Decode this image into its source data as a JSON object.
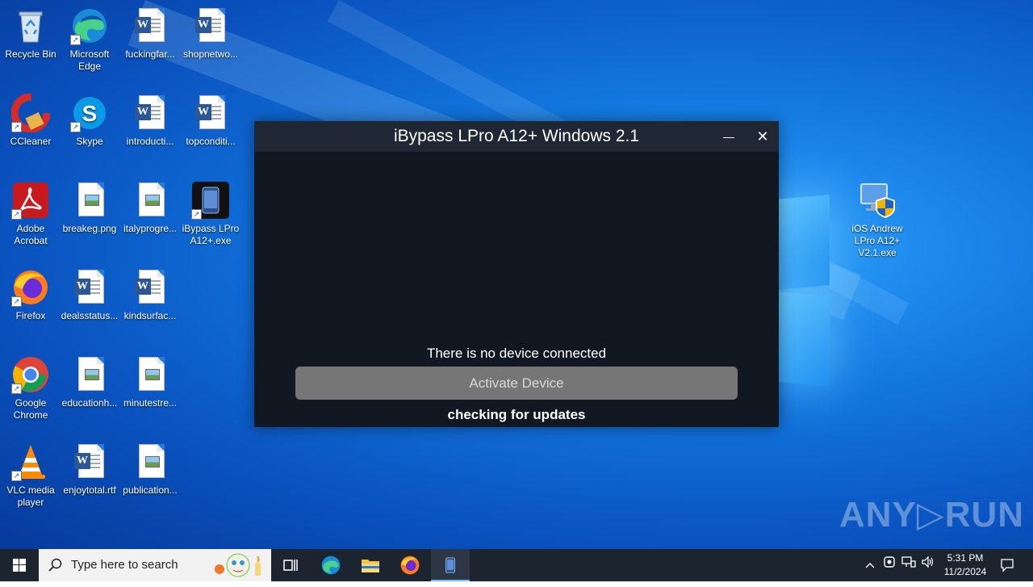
{
  "desktop": {
    "icons": [
      {
        "label": "Recycle Bin"
      },
      {
        "label": "Microsoft Edge"
      },
      {
        "label": "fuckingfar..."
      },
      {
        "label": "shopnetwo..."
      },
      {
        "label": "CCleaner"
      },
      {
        "label": "Skype"
      },
      {
        "label": "introducti..."
      },
      {
        "label": "topconditi..."
      },
      {
        "label": "Adobe Acrobat"
      },
      {
        "label": "breakeg.png"
      },
      {
        "label": "italyprogre..."
      },
      {
        "label": "iBypass LPro A12+.exe"
      },
      {
        "label": "Firefox"
      },
      {
        "label": "dealsstatus..."
      },
      {
        "label": "kindsurfac..."
      },
      {
        "label": "Google Chrome"
      },
      {
        "label": "educationh..."
      },
      {
        "label": "minutestre..."
      },
      {
        "label": "VLC media player"
      },
      {
        "label": "enjoytotal.rtf"
      },
      {
        "label": "publication..."
      },
      {
        "label": "iOS Andrew LPro A12+ V2.1.exe"
      }
    ]
  },
  "app_window": {
    "title": "iBypass LPro A12+ Windows 2.1",
    "minimize_glyph": "—",
    "close_glyph": "✕",
    "status_text": "There is no device connected",
    "activate_button_label": "Activate Device",
    "update_text": "checking for updates"
  },
  "watermark": {
    "text": "ANY▷RUN"
  },
  "taskbar": {
    "search_placeholder": "Type here to search",
    "clock_time": "5:31 PM",
    "clock_date": "11/2/2024"
  },
  "colors": {
    "desktop_blue": "#1378e0",
    "app_bg": "#111822",
    "app_titlebar": "#1e2733",
    "button_gray": "#767676",
    "taskbar": "#1c2430"
  }
}
